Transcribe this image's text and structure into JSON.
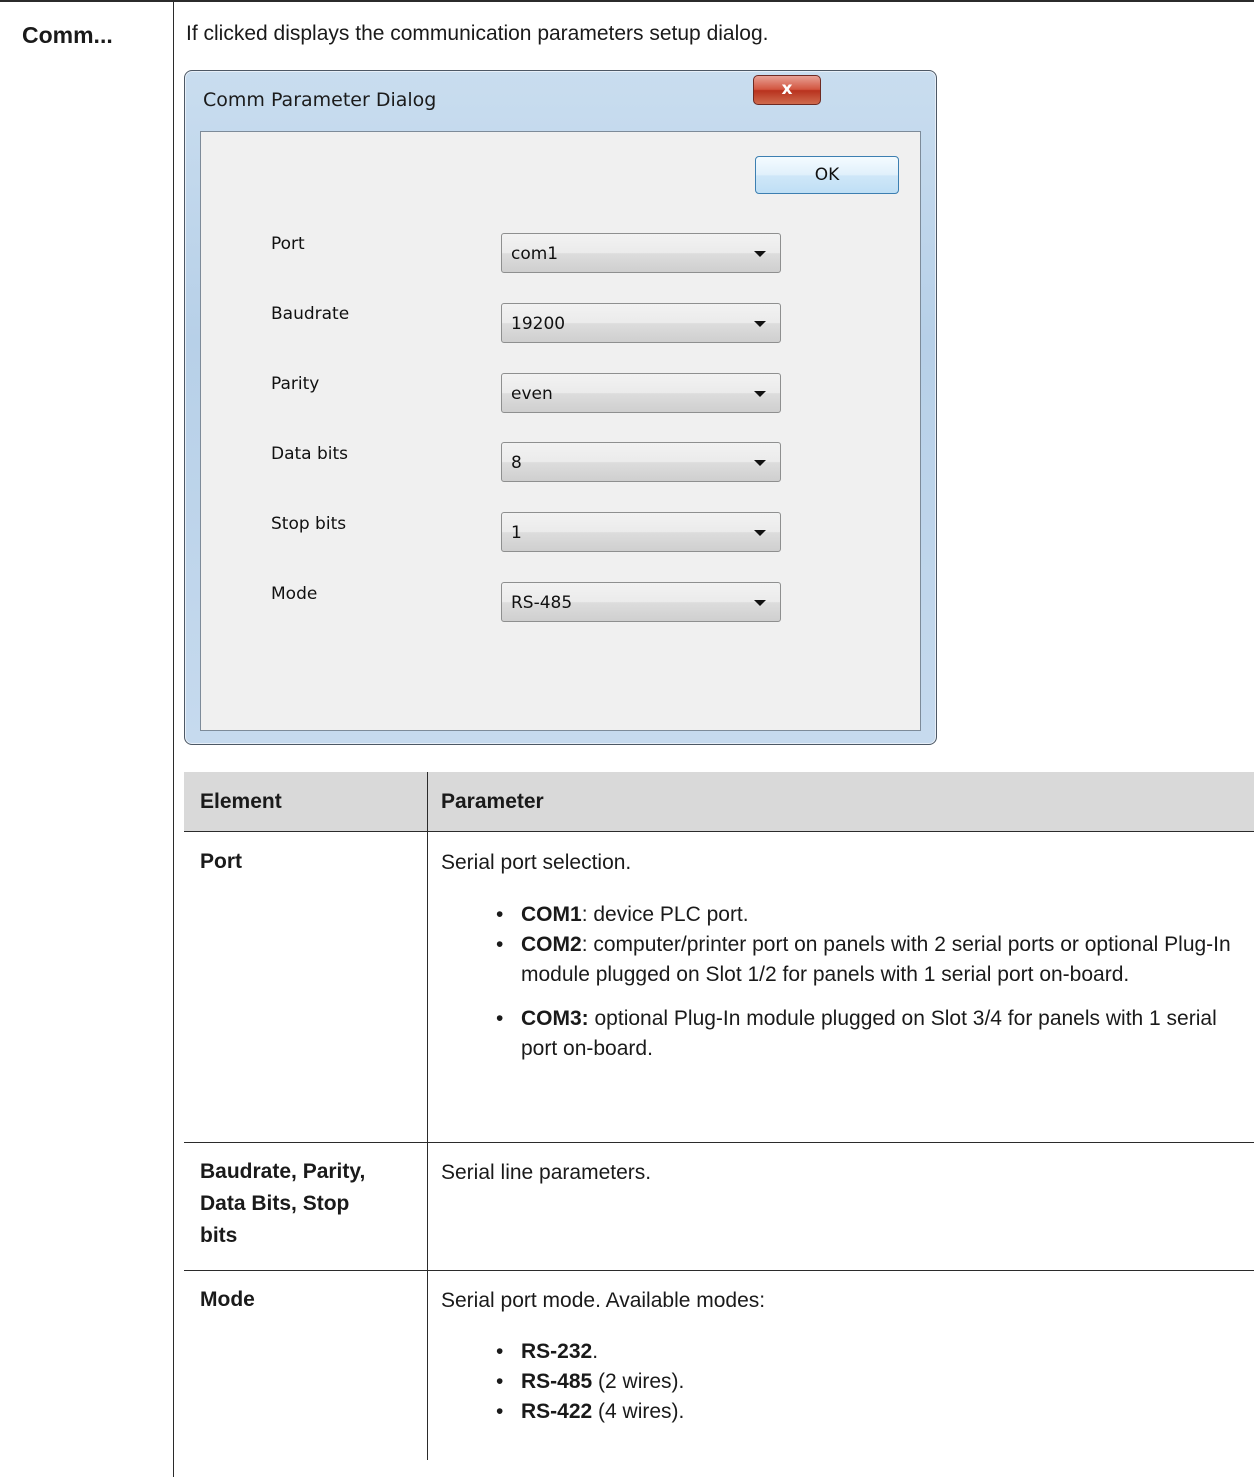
{
  "comm": {
    "label": "Comm...",
    "description": "If clicked displays the communication parameters setup dialog."
  },
  "dialog": {
    "title": "Comm Parameter Dialog",
    "close_glyph": "x",
    "ok_label": "OK",
    "fields": [
      {
        "label": "Port",
        "value": "com1"
      },
      {
        "label": "Baudrate",
        "value": "19200"
      },
      {
        "label": "Parity",
        "value": "even"
      },
      {
        "label": "Data bits",
        "value": "8"
      },
      {
        "label": "Stop bits",
        "value": "1"
      },
      {
        "label": "Mode",
        "value": "RS-485"
      }
    ]
  },
  "table": {
    "headers": [
      "Element",
      "Parameter"
    ],
    "rows": [
      {
        "element": "Port",
        "description": "Serial port selection.",
        "bullets": [
          {
            "term": "COM1",
            "text": ": device PLC port."
          },
          {
            "term": "COM2",
            "text": ": computer/printer port on panels with 2 serial ports or optional Plug-In module plugged on Slot 1/2 for panels with 1 serial port on-board."
          },
          {
            "term": "COM3:",
            "text": " optional Plug-In module plugged on Slot 3/4 for panels with 1 serial port on-board."
          }
        ]
      },
      {
        "element": "Baudrate, Parity, Data Bits, Stop bits",
        "element_lines": [
          "Baudrate, Parity,",
          "Data Bits, Stop",
          "bits"
        ],
        "description": "Serial line parameters."
      },
      {
        "element": "Mode",
        "description": "Serial port mode. Available modes:",
        "bullets": [
          {
            "term": "RS-232",
            "text": "."
          },
          {
            "term": "RS-485",
            "text": " (2 wires)."
          },
          {
            "term": "RS-422",
            "text": " (4 wires)."
          }
        ]
      }
    ]
  },
  "colors": {
    "dialog_frame": "#b7d0e8",
    "dialog_client": "#f0f0f0",
    "close_button": "#c9432c",
    "table_header_bg": "#d9d9d9",
    "rule": "#2b2b2b"
  }
}
